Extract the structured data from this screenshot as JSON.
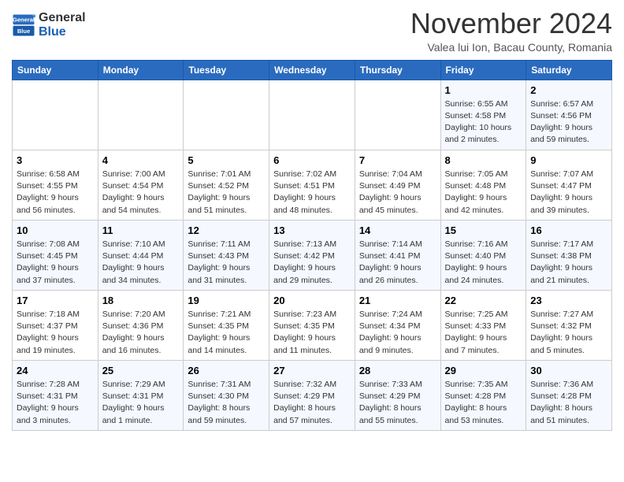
{
  "header": {
    "logo": {
      "general": "General",
      "blue": "Blue"
    },
    "title": "November 2024",
    "location": "Valea lui Ion, Bacau County, Romania"
  },
  "calendar": {
    "weekdays": [
      "Sunday",
      "Monday",
      "Tuesday",
      "Wednesday",
      "Thursday",
      "Friday",
      "Saturday"
    ],
    "weeks": [
      [
        {
          "day": "",
          "info": ""
        },
        {
          "day": "",
          "info": ""
        },
        {
          "day": "",
          "info": ""
        },
        {
          "day": "",
          "info": ""
        },
        {
          "day": "",
          "info": ""
        },
        {
          "day": "1",
          "info": "Sunrise: 6:55 AM\nSunset: 4:58 PM\nDaylight: 10 hours\nand 2 minutes."
        },
        {
          "day": "2",
          "info": "Sunrise: 6:57 AM\nSunset: 4:56 PM\nDaylight: 9 hours\nand 59 minutes."
        }
      ],
      [
        {
          "day": "3",
          "info": "Sunrise: 6:58 AM\nSunset: 4:55 PM\nDaylight: 9 hours\nand 56 minutes."
        },
        {
          "day": "4",
          "info": "Sunrise: 7:00 AM\nSunset: 4:54 PM\nDaylight: 9 hours\nand 54 minutes."
        },
        {
          "day": "5",
          "info": "Sunrise: 7:01 AM\nSunset: 4:52 PM\nDaylight: 9 hours\nand 51 minutes."
        },
        {
          "day": "6",
          "info": "Sunrise: 7:02 AM\nSunset: 4:51 PM\nDaylight: 9 hours\nand 48 minutes."
        },
        {
          "day": "7",
          "info": "Sunrise: 7:04 AM\nSunset: 4:49 PM\nDaylight: 9 hours\nand 45 minutes."
        },
        {
          "day": "8",
          "info": "Sunrise: 7:05 AM\nSunset: 4:48 PM\nDaylight: 9 hours\nand 42 minutes."
        },
        {
          "day": "9",
          "info": "Sunrise: 7:07 AM\nSunset: 4:47 PM\nDaylight: 9 hours\nand 39 minutes."
        }
      ],
      [
        {
          "day": "10",
          "info": "Sunrise: 7:08 AM\nSunset: 4:45 PM\nDaylight: 9 hours\nand 37 minutes."
        },
        {
          "day": "11",
          "info": "Sunrise: 7:10 AM\nSunset: 4:44 PM\nDaylight: 9 hours\nand 34 minutes."
        },
        {
          "day": "12",
          "info": "Sunrise: 7:11 AM\nSunset: 4:43 PM\nDaylight: 9 hours\nand 31 minutes."
        },
        {
          "day": "13",
          "info": "Sunrise: 7:13 AM\nSunset: 4:42 PM\nDaylight: 9 hours\nand 29 minutes."
        },
        {
          "day": "14",
          "info": "Sunrise: 7:14 AM\nSunset: 4:41 PM\nDaylight: 9 hours\nand 26 minutes."
        },
        {
          "day": "15",
          "info": "Sunrise: 7:16 AM\nSunset: 4:40 PM\nDaylight: 9 hours\nand 24 minutes."
        },
        {
          "day": "16",
          "info": "Sunrise: 7:17 AM\nSunset: 4:38 PM\nDaylight: 9 hours\nand 21 minutes."
        }
      ],
      [
        {
          "day": "17",
          "info": "Sunrise: 7:18 AM\nSunset: 4:37 PM\nDaylight: 9 hours\nand 19 minutes."
        },
        {
          "day": "18",
          "info": "Sunrise: 7:20 AM\nSunset: 4:36 PM\nDaylight: 9 hours\nand 16 minutes."
        },
        {
          "day": "19",
          "info": "Sunrise: 7:21 AM\nSunset: 4:35 PM\nDaylight: 9 hours\nand 14 minutes."
        },
        {
          "day": "20",
          "info": "Sunrise: 7:23 AM\nSunset: 4:35 PM\nDaylight: 9 hours\nand 11 minutes."
        },
        {
          "day": "21",
          "info": "Sunrise: 7:24 AM\nSunset: 4:34 PM\nDaylight: 9 hours\nand 9 minutes."
        },
        {
          "day": "22",
          "info": "Sunrise: 7:25 AM\nSunset: 4:33 PM\nDaylight: 9 hours\nand 7 minutes."
        },
        {
          "day": "23",
          "info": "Sunrise: 7:27 AM\nSunset: 4:32 PM\nDaylight: 9 hours\nand 5 minutes."
        }
      ],
      [
        {
          "day": "24",
          "info": "Sunrise: 7:28 AM\nSunset: 4:31 PM\nDaylight: 9 hours\nand 3 minutes."
        },
        {
          "day": "25",
          "info": "Sunrise: 7:29 AM\nSunset: 4:31 PM\nDaylight: 9 hours\nand 1 minute."
        },
        {
          "day": "26",
          "info": "Sunrise: 7:31 AM\nSunset: 4:30 PM\nDaylight: 8 hours\nand 59 minutes."
        },
        {
          "day": "27",
          "info": "Sunrise: 7:32 AM\nSunset: 4:29 PM\nDaylight: 8 hours\nand 57 minutes."
        },
        {
          "day": "28",
          "info": "Sunrise: 7:33 AM\nSunset: 4:29 PM\nDaylight: 8 hours\nand 55 minutes."
        },
        {
          "day": "29",
          "info": "Sunrise: 7:35 AM\nSunset: 4:28 PM\nDaylight: 8 hours\nand 53 minutes."
        },
        {
          "day": "30",
          "info": "Sunrise: 7:36 AM\nSunset: 4:28 PM\nDaylight: 8 hours\nand 51 minutes."
        }
      ]
    ]
  }
}
